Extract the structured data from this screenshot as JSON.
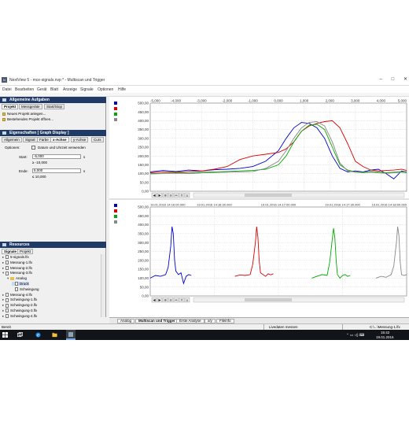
{
  "window": {
    "title": "NextView 5 - mce-signals.nvp * - Multiscan und Trigger",
    "controls": [
      "–",
      "□",
      "✕"
    ]
  },
  "menubar": [
    "Datei",
    "Bearbeiten",
    "Gerät",
    "Blatt",
    "Anzeige",
    "Signale",
    "Optionen",
    "Hilfe"
  ],
  "tasks_panel": {
    "title": "Allgemeine Aufgaben",
    "tabs": [
      "Projekt",
      "Messgeräte",
      "Start/Stop"
    ],
    "items": [
      "Neues Projekt anlegen...",
      "Bestehendes Projekt öffnen..."
    ]
  },
  "props_panel": {
    "title": "Eigenschaften   [ Graph Display ]",
    "tabs": [
      "Allgemein",
      "Signal",
      "Farbe",
      "x-Achse",
      "y-Achse",
      "Curs"
    ],
    "options_label": "Optionen:",
    "datetime_label": "Datum und Uhrzeit verwenden",
    "start_label": "Start:",
    "start_value": "-5,000",
    "start_unit": "s",
    "start_min": "≥  -10,000",
    "end_label": "Ende:",
    "end_value": "5,000",
    "end_unit": "s",
    "end_max": "≤  10,000"
  },
  "resources_panel": {
    "title": "Resources",
    "tabs": [
      "Signale",
      "Projekt"
    ],
    "tree": [
      {
        "label": "5-signals.lfx",
        "type": "file",
        "depth": 0
      },
      {
        "label": "Messung-1.lfx",
        "type": "file",
        "depth": 0
      },
      {
        "label": "Messung-2.lfx",
        "type": "file",
        "depth": 0
      },
      {
        "label": "Messung-3.lfx",
        "type": "file",
        "depth": 0
      },
      {
        "label": "Analog",
        "type": "folder",
        "depth": 1
      },
      {
        "label": "Druck",
        "type": "signal",
        "depth": 2,
        "selected": true
      },
      {
        "label": "Schwingung",
        "type": "signal",
        "depth": 2
      },
      {
        "label": "Messung-4.lfx",
        "type": "file",
        "depth": 0
      },
      {
        "label": "Schwingung-1.lfx",
        "type": "file",
        "depth": 0
      },
      {
        "label": "Schwingung-2.lfx",
        "type": "file",
        "depth": 0
      },
      {
        "label": "Schwingung-3.lfx",
        "type": "file",
        "depth": 0
      },
      {
        "label": "Schwingung-4.lfx",
        "type": "file",
        "depth": 0
      }
    ]
  },
  "chart_data": [
    {
      "type": "line",
      "title": "",
      "xlabel": "",
      "ylabel": "",
      "xlim": [
        -5,
        5
      ],
      "ylim": [
        0,
        500
      ],
      "x_ticks": [
        "-5,000",
        "-4,000",
        "-3,000",
        "-2,000",
        "-1,000",
        "0,000",
        "1,000",
        "2,000",
        "3,000",
        "4,000",
        "5,000"
      ],
      "y_ticks": [
        "500,00",
        "450,00",
        "400,00",
        "350,00",
        "300,00",
        "250,00",
        "200,00",
        "150,00",
        "100,00",
        "50,00",
        "0,00"
      ],
      "series": [
        {
          "color": "#0000cc",
          "x": [
            -5,
            -4.5,
            -4,
            -3.5,
            -3,
            -2.5,
            -2,
            -1.5,
            -1,
            -0.5,
            0,
            0.3,
            0.6,
            0.9,
            1.2,
            1.5,
            1.8,
            2.1,
            2.4,
            2.7,
            3,
            3.3,
            3.6,
            3.9,
            4.2,
            4.5,
            4.8,
            5
          ],
          "y": [
            110,
            118,
            112,
            120,
            115,
            122,
            125,
            130,
            140,
            170,
            230,
            300,
            360,
            390,
            385,
            360,
            300,
            200,
            130,
            110,
            115,
            110,
            120,
            125,
            100,
            70,
            115,
            110
          ]
        },
        {
          "color": "#dd0000",
          "x": [
            -5,
            -4.5,
            -4,
            -3.5,
            -3,
            -2.5,
            -2,
            -1.5,
            -1,
            -0.5,
            0,
            0.3,
            0.6,
            0.9,
            1.2,
            1.5,
            1.8,
            2.1,
            2.4,
            2.7,
            3,
            3.3,
            3.6,
            3.9,
            4.2,
            4.5,
            4.8,
            5
          ],
          "y": [
            105,
            110,
            108,
            112,
            115,
            125,
            140,
            180,
            200,
            210,
            220,
            240,
            280,
            340,
            370,
            385,
            395,
            400,
            360,
            270,
            170,
            140,
            120,
            115,
            118,
            120,
            125,
            118
          ]
        },
        {
          "color": "#00aa00",
          "x": [
            -5,
            -4.5,
            -4,
            -3.5,
            -3,
            -2.5,
            -2,
            -1.5,
            -1,
            -0.5,
            0,
            0.3,
            0.6,
            0.9,
            1.2,
            1.5,
            1.8,
            2.1,
            2.4,
            2.7,
            3,
            3.3,
            3.6,
            3.9,
            4.2,
            4.5,
            4.8,
            5
          ],
          "y": [
            100,
            102,
            105,
            103,
            108,
            110,
            112,
            115,
            118,
            125,
            150,
            200,
            280,
            340,
            375,
            380,
            350,
            250,
            150,
            120,
            110,
            108,
            112,
            110,
            105,
            108,
            112,
            110
          ]
        },
        {
          "color": "#888888",
          "x": [
            -5,
            -4.5,
            -4,
            -3.5,
            -3,
            -2.5,
            -2,
            -1.5,
            -1,
            -0.5,
            0,
            0.3,
            0.6,
            0.9,
            1.2,
            1.5,
            1.8,
            2.1,
            2.4,
            2.7,
            3,
            3.3,
            3.6,
            3.9,
            4.2,
            4.5,
            4.8,
            5
          ],
          "y": [
            98,
            100,
            102,
            100,
            104,
            106,
            108,
            110,
            112,
            130,
            170,
            230,
            300,
            360,
            390,
            395,
            370,
            280,
            160,
            115,
            108,
            105,
            108,
            104,
            102,
            105,
            108,
            104
          ]
        }
      ]
    },
    {
      "type": "line",
      "title": "",
      "xlabel": "",
      "ylabel": "",
      "xlim": [
        0,
        100
      ],
      "ylim": [
        0,
        500
      ],
      "x_ticks": [
        "19.01.2016  14:16:00.000",
        "19.01.2016  14:16:30.000",
        "19.01.2016  14:17:00.000",
        "19.01.2016  14:17:30.000",
        "19.01.2016  14:18:00.000"
      ],
      "y_ticks": [
        "500,00",
        "450,00",
        "400,00",
        "350,00",
        "300,00",
        "250,00",
        "200,00",
        "150,00",
        "100,00",
        "50,00",
        "0,00"
      ],
      "series": [
        {
          "color": "#0000cc",
          "x": [
            0,
            2,
            4,
            6,
            7,
            8,
            8.5,
            9,
            9.5,
            10,
            11,
            12,
            13,
            14,
            15,
            16
          ],
          "y": [
            100,
            115,
            110,
            120,
            160,
            280,
            390,
            350,
            200,
            140,
            120,
            130,
            70,
            110,
            120,
            115
          ]
        },
        {
          "color": "#dd0000",
          "x": [
            33,
            35,
            37,
            39,
            40,
            41,
            41.5,
            42,
            42.5,
            43,
            44,
            45,
            46,
            47,
            48
          ],
          "y": [
            110,
            118,
            115,
            120,
            180,
            300,
            390,
            330,
            200,
            130,
            120,
            110,
            125,
            118,
            125
          ]
        },
        {
          "color": "#00aa00",
          "x": [
            63,
            65,
            67,
            69,
            70,
            71,
            71.5,
            72,
            72.5,
            73,
            74,
            75,
            76,
            77,
            78
          ],
          "y": [
            100,
            110,
            120,
            115,
            190,
            320,
            380,
            330,
            200,
            120,
            100,
            115,
            120,
            110,
            115
          ]
        },
        {
          "color": "#888888",
          "x": [
            88,
            90,
            92,
            94,
            95,
            96,
            96.5,
            97,
            97.5,
            98,
            99,
            100
          ],
          "y": [
            100,
            110,
            105,
            120,
            170,
            300,
            390,
            340,
            190,
            120,
            115,
            120
          ]
        }
      ]
    }
  ],
  "chart_toolbar": [
    "◀",
    "▶",
    "⊕",
    "⊖",
    "↔",
    "↕",
    "⌂"
  ],
  "bottom_tabs": [
    "Analog",
    "Multiscan und Trigger",
    "Erste Analyse",
    "x/y",
    "Fileinfo"
  ],
  "status": {
    "left": "Bereit",
    "middle": "Livedaten messen",
    "right": "C:\\...\\Messung-1.lfx"
  },
  "taskbar": {
    "time": "15:42",
    "date": "19.01.2016"
  }
}
